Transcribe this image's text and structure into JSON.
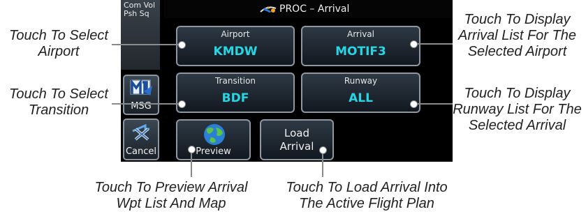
{
  "screen": {
    "title": "PROC – Arrival",
    "com_vol": "Com Vol\nPsh Sq",
    "airport": {
      "label": "Airport",
      "value": "KMDW"
    },
    "arrival": {
      "label": "Arrival",
      "value": "MOTIF3"
    },
    "transition": {
      "label": "Transition",
      "value": "BDF"
    },
    "runway": {
      "label": "Runway",
      "value": "ALL"
    },
    "preview_label": "Preview",
    "load_label_1": "Load",
    "load_label_2": "Arrival",
    "msg_label": "MSG",
    "cancel_label": "Cancel"
  },
  "callouts": {
    "select_airport": [
      "Touch To Select",
      "Airport"
    ],
    "select_transition": [
      "Touch To Select",
      "Transition"
    ],
    "arrival_list": [
      "Touch To Display",
      "Arrival List For The",
      "Selected Airport"
    ],
    "runway_list": [
      "Touch To Display",
      "Runway List For The",
      "Selected Arrival"
    ],
    "preview": [
      "Touch To Preview Arrival",
      "Wpt List And Map"
    ],
    "load": [
      "Touch To Load Arrival Into",
      "The Active Flight Plan"
    ]
  },
  "colors": {
    "value_cyan": "#27d6e4",
    "button_border": "#8e98a3",
    "screen_bg": "#000000"
  }
}
